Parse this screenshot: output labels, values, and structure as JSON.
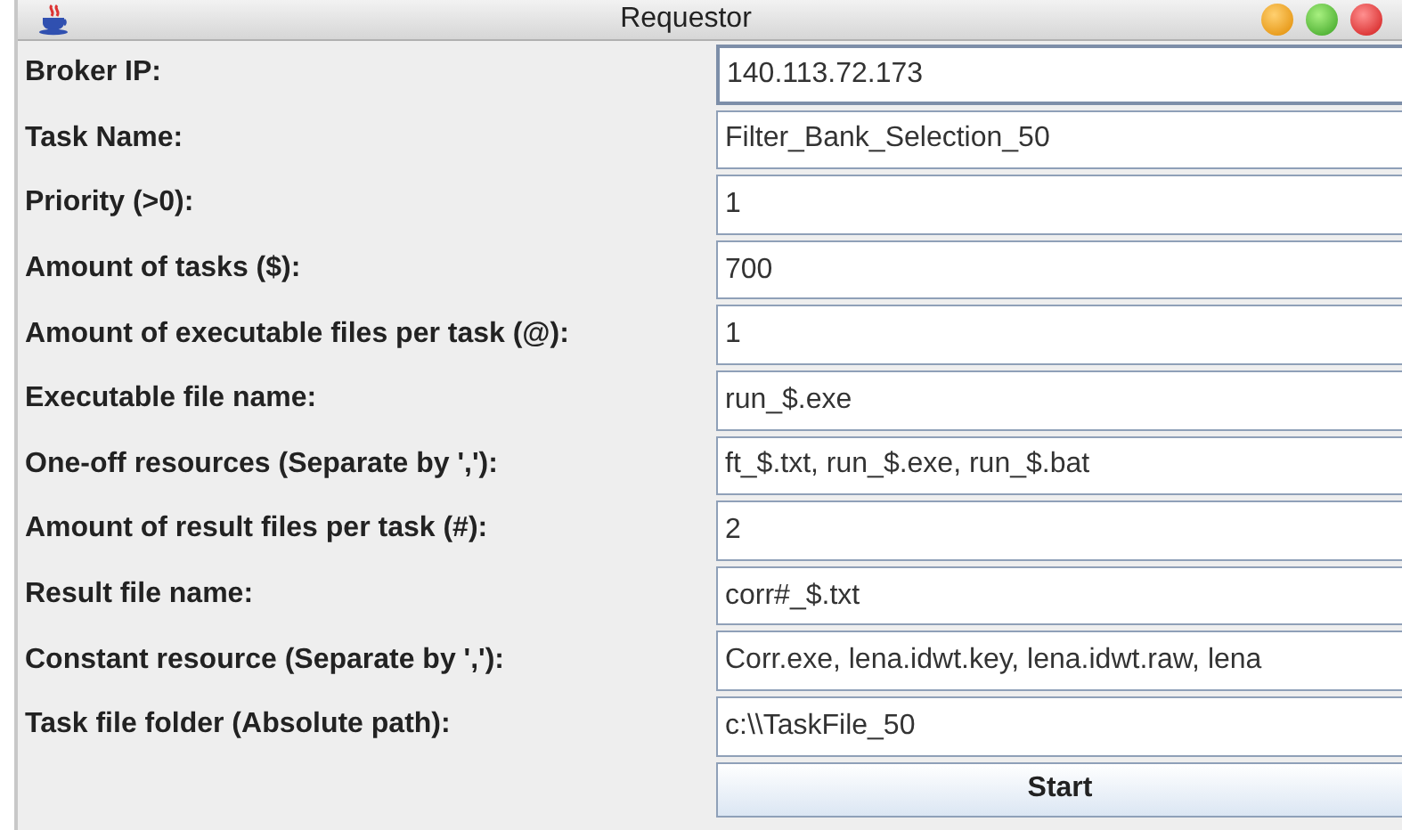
{
  "window": {
    "title": "Requestor"
  },
  "fields": [
    {
      "label": "Broker IP:",
      "value": "140.113.72.173",
      "focused": true
    },
    {
      "label": "Task Name:",
      "value": "Filter_Bank_Selection_50",
      "focused": false
    },
    {
      "label": "Priority (>0):",
      "value": "1",
      "focused": false
    },
    {
      "label": "Amount of tasks ($):",
      "value": "700",
      "focused": false
    },
    {
      "label": "Amount of executable files per task (@):",
      "value": "1",
      "focused": false
    },
    {
      "label": "Executable file name:",
      "value": "run_$.exe",
      "focused": false
    },
    {
      "label": "One-off resources (Separate by ','):",
      "value": "ft_$.txt, run_$.exe, run_$.bat",
      "focused": false
    },
    {
      "label": "Amount of result files per task (#):",
      "value": "2",
      "focused": false
    },
    {
      "label": "Result file name:",
      "value": "corr#_$.txt",
      "focused": false
    },
    {
      "label": "Constant resource (Separate by ','):",
      "value": "Corr.exe, lena.idwt.key, lena.idwt.raw, lena",
      "focused": false
    },
    {
      "label": "Task file folder (Absolute path):",
      "value": "c:\\\\TaskFile_50",
      "focused": false
    }
  ],
  "buttons": [
    "Start"
  ]
}
